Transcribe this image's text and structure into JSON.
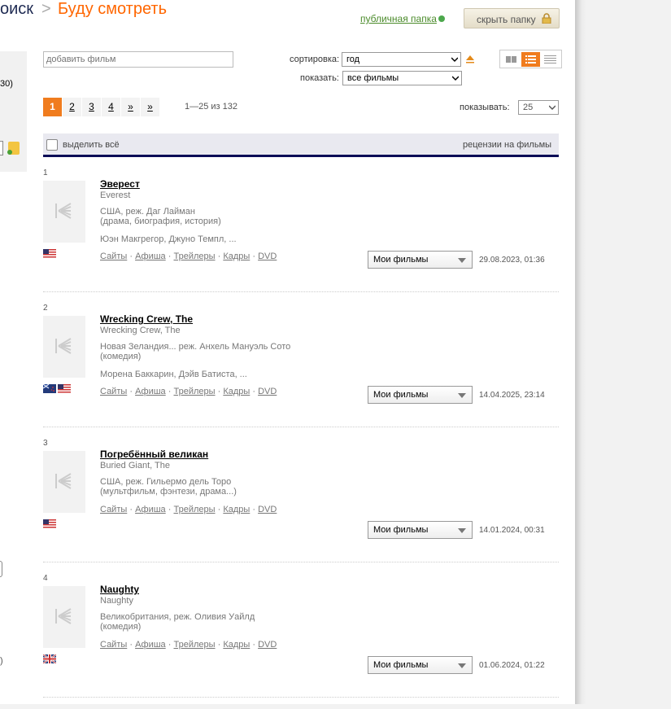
{
  "breadcrumb": {
    "search": "оиск",
    "sep": ">",
    "title": "Буду смотреть"
  },
  "header": {
    "public_link": "публичная папка",
    "hide_button": "скрыть папку"
  },
  "sidebar": {
    "count_text": "30)",
    "paren_text": ")"
  },
  "controls": {
    "add_placeholder": "добавить фильм",
    "sort_label": "сортировка:",
    "sort_value": "год",
    "show_label": "показать:",
    "show_value": "все фильмы"
  },
  "pagination": {
    "pages": [
      "1",
      "2",
      "3",
      "4",
      "»",
      "»"
    ],
    "current": "1",
    "range": "1—25 из 132",
    "per_page_label": "показывать:",
    "per_page_value": "25"
  },
  "list_header": {
    "select_all": "выделить всё",
    "reviews": "рецензии на фильмы"
  },
  "films": [
    {
      "num": "1",
      "title": "Эверест",
      "original": "Everest",
      "meta1": "США, реж. Даг Лайман",
      "meta2": "(драма, биография, история)",
      "cast": "Юэн Макгрегор, Джуно Темпл, ...",
      "flags": [
        "us"
      ],
      "folder": "Мои фильмы",
      "date": "29.08.2023, 01:36"
    },
    {
      "num": "2",
      "title": "Wrecking Crew, The",
      "original": "Wrecking Crew, The",
      "meta1": "Новая Зеландия... реж. Анхель Мануэль Сото",
      "meta2": "(комедия)",
      "cast": "Морена Баккарин, Дэйв Батиста, ...",
      "flags": [
        "nz",
        "us"
      ],
      "folder": "Мои фильмы",
      "date": "14.04.2025, 23:14"
    },
    {
      "num": "3",
      "title": "Погребённый великан",
      "original": "Buried Giant, The",
      "meta1": "США, реж. Гильермо дель Торо",
      "meta2": "(мультфильм, фэнтези, драма...)",
      "cast": "",
      "flags": [
        "us"
      ],
      "folder": "Мои фильмы",
      "date": "14.01.2024, 00:31"
    },
    {
      "num": "4",
      "title": "Naughty",
      "original": "Naughty",
      "meta1": "Великобритания, реж. Оливия Уайлд",
      "meta2": "(комедия)",
      "cast": "",
      "flags": [
        "gb"
      ],
      "folder": "Мои фильмы",
      "date": "01.06.2024, 01:22"
    }
  ],
  "film_links": [
    "Сайты",
    "Афиша",
    "Трейлеры",
    "Кадры",
    "DVD"
  ],
  "link_sep": "·"
}
